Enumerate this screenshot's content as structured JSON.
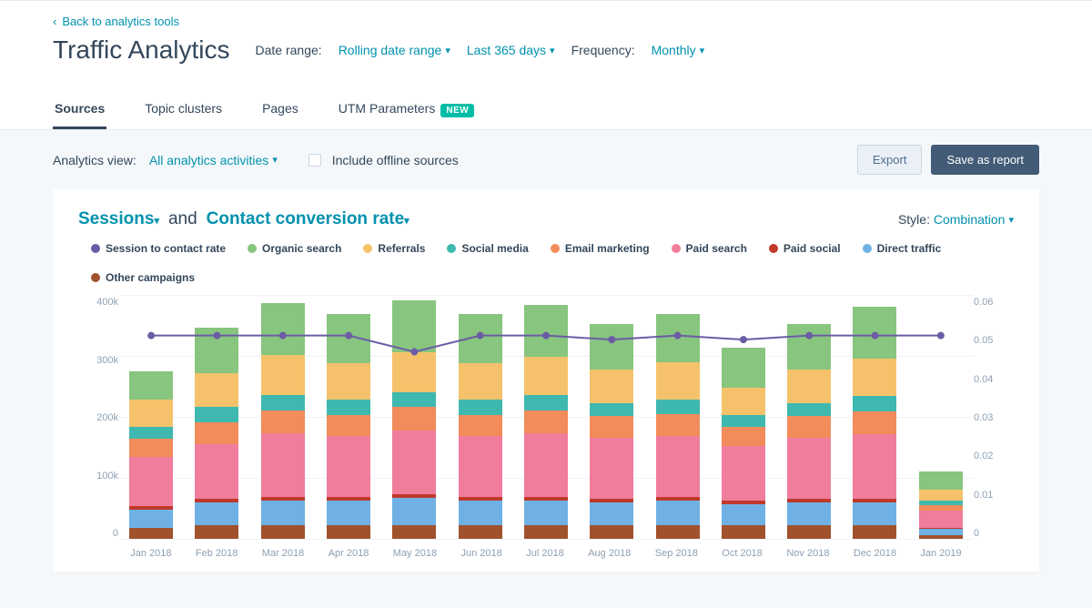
{
  "back_link": "Back to analytics tools",
  "page_title": "Traffic Analytics",
  "filters": {
    "date_range_label": "Date range:",
    "rolling": "Rolling date range",
    "period": "Last 365 days",
    "frequency_label": "Frequency:",
    "frequency": "Monthly"
  },
  "tabs": [
    {
      "label": "Sources",
      "active": true
    },
    {
      "label": "Topic clusters",
      "active": false
    },
    {
      "label": "Pages",
      "active": false
    },
    {
      "label": "UTM Parameters",
      "active": false,
      "badge": "NEW"
    }
  ],
  "subbar": {
    "analytics_view_label": "Analytics view:",
    "analytics_view_value": "All analytics activities",
    "offline_label": "Include offline sources",
    "export": "Export",
    "save": "Save as report"
  },
  "card": {
    "metric1": "Sessions",
    "and": "and",
    "metric2": "Contact conversion rate",
    "style_label": "Style:",
    "style_value": "Combination"
  },
  "legend": [
    {
      "label": "Session to contact rate",
      "color": "#6b5ca5"
    },
    {
      "label": "Organic search",
      "color": "#88c57f"
    },
    {
      "label": "Referrals",
      "color": "#f5c26b"
    },
    {
      "label": "Social media",
      "color": "#3fb8af"
    },
    {
      "label": "Email marketing",
      "color": "#f28c5b"
    },
    {
      "label": "Paid search",
      "color": "#f07d9c"
    },
    {
      "label": "Paid social",
      "color": "#c0392b"
    },
    {
      "label": "Direct traffic",
      "color": "#6fb1e4"
    },
    {
      "label": "Other campaigns",
      "color": "#a0522d"
    }
  ],
  "y_left": [
    "400k",
    "300k",
    "200k",
    "100k",
    "0"
  ],
  "y_right": [
    "0.06",
    "0.05",
    "0.04",
    "0.03",
    "0.02",
    "0.01",
    "0"
  ],
  "chart_data": {
    "type": "bar",
    "stacked": true,
    "title": "",
    "xlabel": "",
    "ylabel_left": "Sessions",
    "ylabel_right": "Contact conversion rate",
    "ylim_left": [
      0,
      400000
    ],
    "ylim_right": [
      0,
      0.06
    ],
    "categories": [
      "Jan 2018",
      "Feb 2018",
      "Mar 2018",
      "Apr 2018",
      "May 2018",
      "Jun 2018",
      "Jul 2018",
      "Aug 2018",
      "Sep 2018",
      "Oct 2018",
      "Nov 2018",
      "Dec 2018",
      "Jan 2019"
    ],
    "series": [
      {
        "name": "Other campaigns",
        "color": "#a0522d",
        "values": [
          18000,
          22000,
          22000,
          22000,
          22000,
          22000,
          22000,
          22000,
          22000,
          22000,
          22000,
          22000,
          6000
        ]
      },
      {
        "name": "Direct traffic",
        "color": "#6fb1e4",
        "values": [
          30000,
          38000,
          40000,
          40000,
          45000,
          40000,
          40000,
          38000,
          40000,
          35000,
          38000,
          38000,
          10000
        ]
      },
      {
        "name": "Paid social",
        "color": "#c0392b",
        "values": [
          6000,
          6000,
          6000,
          6000,
          6000,
          6000,
          6000,
          6000,
          6000,
          6000,
          6000,
          6000,
          2000
        ]
      },
      {
        "name": "Paid search",
        "color": "#f07d9c",
        "values": [
          80000,
          90000,
          105000,
          100000,
          105000,
          100000,
          105000,
          100000,
          100000,
          90000,
          100000,
          105000,
          28000
        ]
      },
      {
        "name": "Email marketing",
        "color": "#f28c5b",
        "values": [
          30000,
          35000,
          38000,
          35000,
          38000,
          35000,
          38000,
          35000,
          36000,
          30000,
          35000,
          38000,
          10000
        ]
      },
      {
        "name": "Social media",
        "color": "#3fb8af",
        "values": [
          20000,
          25000,
          25000,
          25000,
          25000,
          25000,
          25000,
          22000,
          25000,
          20000,
          22000,
          25000,
          7000
        ]
      },
      {
        "name": "Referrals",
        "color": "#f5c26b",
        "values": [
          45000,
          55000,
          65000,
          60000,
          65000,
          60000,
          62000,
          55000,
          60000,
          45000,
          55000,
          62000,
          18000
        ]
      },
      {
        "name": "Organic search",
        "color": "#88c57f",
        "values": [
          45000,
          75000,
          85000,
          80000,
          85000,
          80000,
          85000,
          75000,
          80000,
          65000,
          75000,
          85000,
          30000
        ]
      }
    ],
    "line_series": {
      "name": "Session to contact rate",
      "color": "#6b5ca5",
      "axis": "right",
      "values": [
        0.05,
        0.05,
        0.05,
        0.05,
        0.046,
        0.05,
        0.05,
        0.049,
        0.05,
        0.049,
        0.05,
        0.05,
        0.05
      ]
    }
  }
}
